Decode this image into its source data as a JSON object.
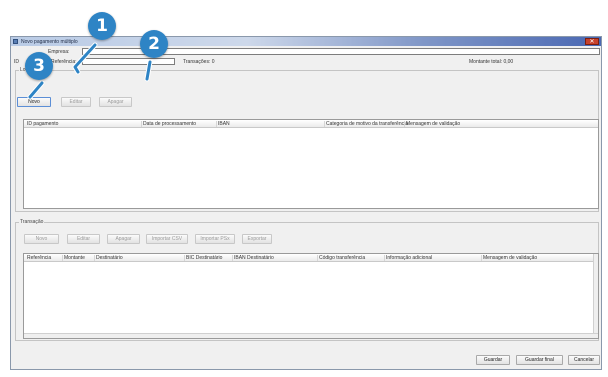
{
  "window": {
    "title": "Novo pagamento múltiplo"
  },
  "header": {
    "company_label": "Empresa:",
    "id_label": "ID",
    "reference_label": "Referência:",
    "transactions_label": "Transações: 0",
    "total_label": "Montante total: 0,00"
  },
  "lotes": {
    "title": "Lotes",
    "buttons": [
      "Novo",
      "Editar",
      "Apagar"
    ],
    "columns": [
      "ID pagamento",
      "Data de processamento",
      "IBAN",
      "Categoria de motivo da transferência",
      "Mensagem de validação"
    ]
  },
  "transacao": {
    "title": "Transação",
    "buttons": [
      "Novo",
      "Editar",
      "Apagar",
      "Importar CSV",
      "Importar PSx",
      "Exportar"
    ],
    "columns": [
      "Referência",
      "Montante",
      "Destinatário",
      "BIC Destinatário",
      "IBAN Destinatário",
      "Código transferência",
      "Informação adicional",
      "Mensagem de validação"
    ]
  },
  "footer": {
    "save_label": "Guardar",
    "save_final_label": "Guardar final",
    "cancel_label": "Cancelar"
  },
  "callouts": [
    "1",
    "2",
    "3"
  ],
  "colors": {
    "callout": "#2e84c5",
    "title_gradient_end": "#4a68b3",
    "close_button": "#c8412b"
  }
}
